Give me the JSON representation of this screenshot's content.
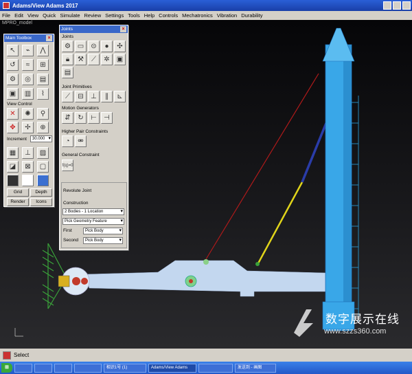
{
  "window": {
    "title": "Adams/View Adams 2017"
  },
  "menu": [
    "File",
    "Edit",
    "View",
    "Quick",
    "Simulate",
    "Review",
    "Settings",
    "Tools",
    "Help",
    "Controls",
    "Mechatronics",
    "Vibration",
    "Durability"
  ],
  "model_name": "MPRO_model",
  "main_toolbox": {
    "title": "Main Toolbox",
    "section_view": "View Control",
    "increment_label": "Increment",
    "increment_value": "30.000",
    "grid_button": "Grid",
    "depth_button": "Depth",
    "render_button": "Render",
    "icons_button": "Icons"
  },
  "joints_palette": {
    "title": "Joints",
    "section_joints": "Joints",
    "section_primitives": "Joint Primitives",
    "section_motion": "Motion Generators",
    "section_higher_pair": "Higher Pair Constraints",
    "section_general": "General Constraint",
    "general_icon_text": "f(q)=0",
    "selected_tool": "Revolute Joint",
    "construction_label": "Construction",
    "construction_option": "2 Bodies - 1 Location",
    "pick_option": "Pick Geometry Feature",
    "first_label": "First",
    "first_value": "Pick Body",
    "second_label": "Second",
    "second_value": "Pick Body"
  },
  "status": {
    "text": "Select"
  },
  "taskbar": [
    "",
    "",
    "",
    "",
    "相识1号 (1)",
    "Adams/View Adams",
    "",
    "发送到 - 画图"
  ],
  "watermark": {
    "text": "数字展示在线",
    "url": "www.szzs360.com"
  },
  "colors": {
    "tower": "#39a7e8",
    "beam": "#c3d7ef",
    "cable_red": "#b11a1a",
    "cable_yellow": "#e0d41a",
    "cable_blue": "#2a3ca8",
    "truss": "#3aa23a"
  }
}
